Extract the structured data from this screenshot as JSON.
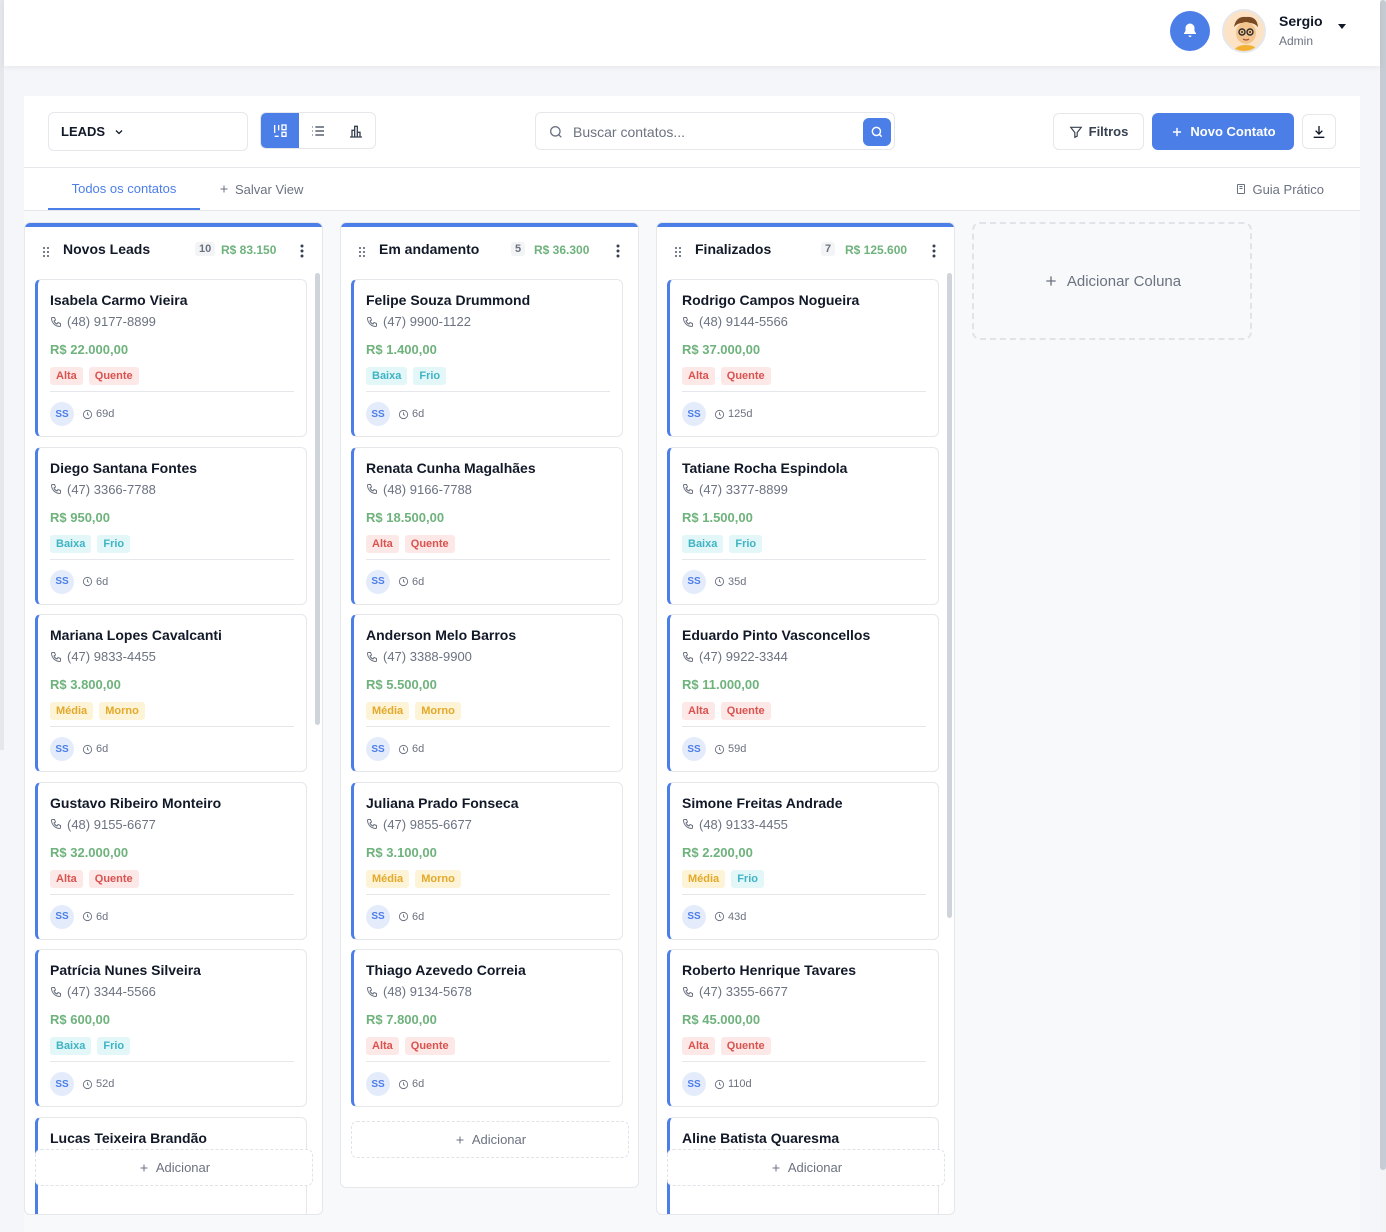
{
  "user": {
    "name": "Sergio",
    "role": "Admin"
  },
  "toolbar": {
    "pipeline": "LEADS",
    "search_placeholder": "Buscar contatos...",
    "filters_label": "Filtros",
    "new_contact_label": "Novo Contato"
  },
  "tabs": {
    "all_contacts": "Todos os contatos",
    "save_view": "Salvar View",
    "guide": "Guia Prático"
  },
  "add_label": "Adicionar",
  "add_column_label": "Adicionar Coluna",
  "columns": [
    {
      "title": "Novos Leads",
      "count": "10",
      "total": "R$ 83.150",
      "cards": [
        {
          "name": "Isabela Carmo Vieira",
          "phone": "(48) 9177-8899",
          "value": "R$ 22.000,00",
          "tags": [
            "Alta",
            "Quente"
          ],
          "owner": "SS",
          "age": "69d"
        },
        {
          "name": "Diego Santana Fontes",
          "phone": "(47) 3366-7788",
          "value": "R$ 950,00",
          "tags": [
            "Baixa",
            "Frio"
          ],
          "owner": "SS",
          "age": "6d"
        },
        {
          "name": "Mariana Lopes Cavalcanti",
          "phone": "(47) 9833-4455",
          "value": "R$ 3.800,00",
          "tags": [
            "Média",
            "Morno"
          ],
          "owner": "SS",
          "age": "6d"
        },
        {
          "name": "Gustavo Ribeiro Monteiro",
          "phone": "(48) 9155-6677",
          "value": "R$ 32.000,00",
          "tags": [
            "Alta",
            "Quente"
          ],
          "owner": "SS",
          "age": "6d"
        },
        {
          "name": "Patrícia Nunes Silveira",
          "phone": "(47) 3344-5566",
          "value": "R$ 600,00",
          "tags": [
            "Baixa",
            "Frio"
          ],
          "owner": "SS",
          "age": "52d"
        },
        {
          "name": "Lucas Teixeira Brandão"
        }
      ]
    },
    {
      "title": "Em andamento",
      "count": "5",
      "total": "R$ 36.300",
      "cards": [
        {
          "name": "Felipe Souza Drummond",
          "phone": "(47) 9900-1122",
          "value": "R$ 1.400,00",
          "tags": [
            "Baixa",
            "Frio"
          ],
          "owner": "SS",
          "age": "6d"
        },
        {
          "name": "Renata Cunha Magalhães",
          "phone": "(48) 9166-7788",
          "value": "R$ 18.500,00",
          "tags": [
            "Alta",
            "Quente"
          ],
          "owner": "SS",
          "age": "6d"
        },
        {
          "name": "Anderson Melo Barros",
          "phone": "(47) 3388-9900",
          "value": "R$ 5.500,00",
          "tags": [
            "Média",
            "Morno"
          ],
          "owner": "SS",
          "age": "6d"
        },
        {
          "name": "Juliana Prado Fonseca",
          "phone": "(47) 9855-6677",
          "value": "R$ 3.100,00",
          "tags": [
            "Média",
            "Morno"
          ],
          "owner": "SS",
          "age": "6d"
        },
        {
          "name": "Thiago Azevedo Correia",
          "phone": "(48) 9134-5678",
          "value": "R$ 7.800,00",
          "tags": [
            "Alta",
            "Quente"
          ],
          "owner": "SS",
          "age": "6d"
        }
      ]
    },
    {
      "title": "Finalizados",
      "count": "7",
      "total": "R$ 125.600",
      "cards": [
        {
          "name": "Rodrigo Campos Nogueira",
          "phone": "(48) 9144-5566",
          "value": "R$ 37.000,00",
          "tags": [
            "Alta",
            "Quente"
          ],
          "owner": "SS",
          "age": "125d"
        },
        {
          "name": "Tatiane Rocha Espindola",
          "phone": "(47) 3377-8899",
          "value": "R$ 1.500,00",
          "tags": [
            "Baixa",
            "Frio"
          ],
          "owner": "SS",
          "age": "35d"
        },
        {
          "name": "Eduardo Pinto Vasconcellos",
          "phone": "(47) 9922-3344",
          "value": "R$ 11.000,00",
          "tags": [
            "Alta",
            "Quente"
          ],
          "owner": "SS",
          "age": "59d"
        },
        {
          "name": "Simone Freitas Andrade",
          "phone": "(48) 9133-4455",
          "value": "R$ 2.200,00",
          "tags": [
            "Média",
            "Frio"
          ],
          "owner": "SS",
          "age": "43d"
        },
        {
          "name": "Roberto Henrique Tavares",
          "phone": "(47) 3355-6677",
          "value": "R$ 45.000,00",
          "tags": [
            "Alta",
            "Quente"
          ],
          "owner": "SS",
          "age": "110d"
        },
        {
          "name": "Aline Batista Quaresma"
        }
      ]
    }
  ]
}
